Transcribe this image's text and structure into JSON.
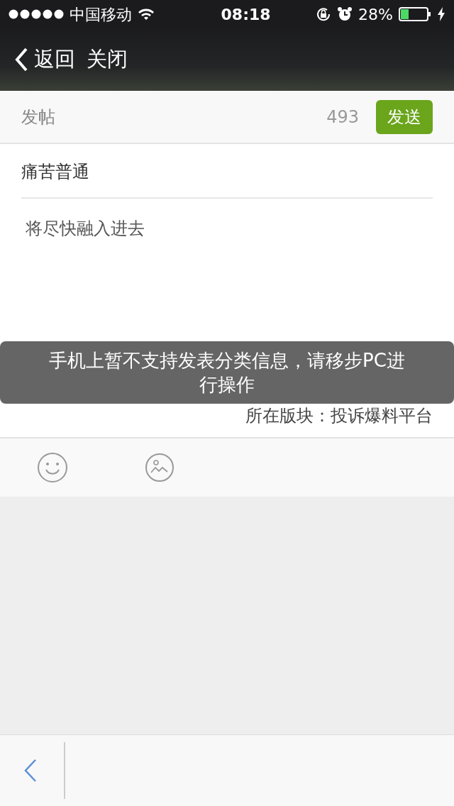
{
  "status_bar": {
    "carrier": "中国移动",
    "time": "08:18",
    "battery": "28%"
  },
  "nav": {
    "back_label": "返回",
    "close_label": "关闭"
  },
  "compose": {
    "title": "发帖",
    "count": "493",
    "send_label": "发送",
    "subject": "痛苦普通",
    "body": "将尽快融入进去",
    "board": "所在版块：投诉爆料平台"
  },
  "toast": {
    "message": "手机上暂不支持发表分类信息，请移步PC进行操作"
  }
}
